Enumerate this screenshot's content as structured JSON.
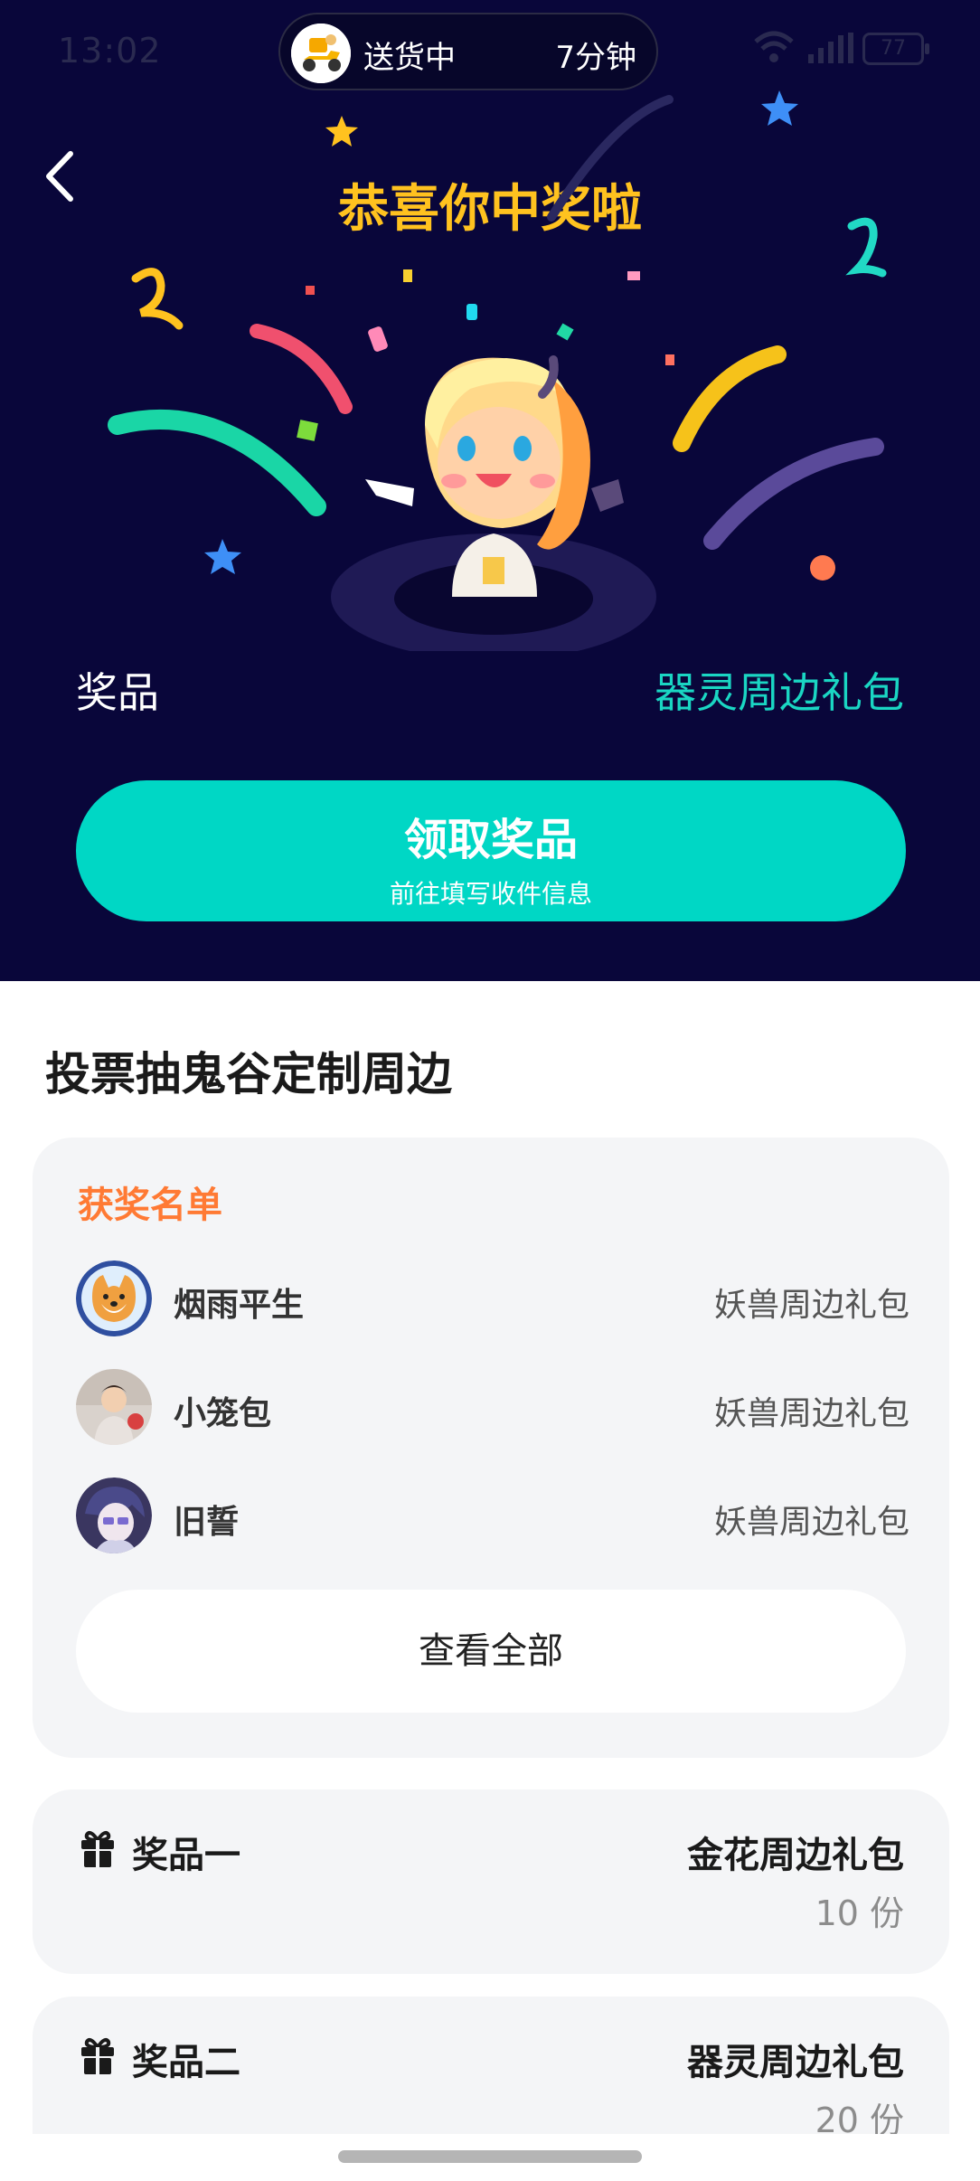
{
  "status_bar": {
    "time": "13:02",
    "delivery_text": "送货中",
    "delivery_eta": "7分钟",
    "battery": "77"
  },
  "hero": {
    "title": "恭喜你中奖啦",
    "prize_label": "奖品",
    "prize_value": "器灵周边礼包",
    "claim_button": {
      "title": "领取奖品",
      "subtitle": "前往填写收件信息"
    }
  },
  "section": {
    "title": "投票抽鬼谷定制周边"
  },
  "winners": {
    "header": "获奖名单",
    "rows": [
      {
        "name": "烟雨平生",
        "prize": "妖兽周边礼包"
      },
      {
        "name": "小笼包",
        "prize": "妖兽周边礼包"
      },
      {
        "name": "旧誓",
        "prize": "妖兽周边礼包"
      }
    ],
    "view_all_label": "查看全部"
  },
  "prizes": [
    {
      "name": "奖品一",
      "title": "金花周边礼包",
      "count": "10 份"
    },
    {
      "name": "奖品二",
      "title": "器灵周边礼包",
      "count": "20 份"
    }
  ],
  "colors": {
    "hero_bg": "#09063a",
    "title_gold": "#ffc21f",
    "accent_teal": "#00d7c5",
    "winners_orange": "#ff7a34"
  }
}
